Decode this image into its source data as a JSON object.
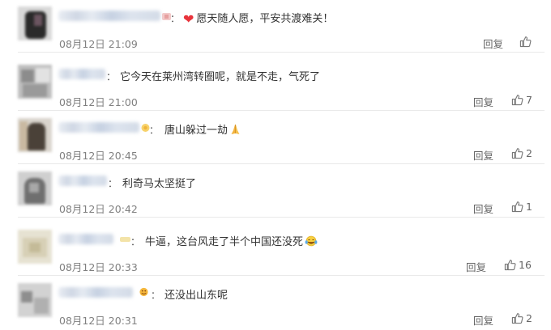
{
  "comments": [
    {
      "text": "愿天随人愿，平安共渡难关！",
      "time": "08月12日 21:09",
      "reply_label": "回复",
      "likes": ""
    },
    {
      "text": "它今天在莱州湾转圈呢，就是不走，气死了",
      "time": "08月12日 21:00",
      "reply_label": "回复",
      "likes": "7"
    },
    {
      "text": "唐山躲过一劫",
      "time": "08月12日 20:45",
      "reply_label": "回复",
      "likes": "2"
    },
    {
      "text": "利奇马太坚挺了",
      "time": "08月12日 20:42",
      "reply_label": "回复",
      "likes": "1"
    },
    {
      "text": "牛逼，这台风走了半个中国还没死",
      "time": "08月12日 20:33",
      "reply_label": "回复",
      "likes": "16"
    },
    {
      "text": "还没出山东呢",
      "time": "08月12日 20:31",
      "reply_label": "回复",
      "likes": "2"
    }
  ],
  "icons": {
    "heart": "red-heart-icon",
    "pray": "folded-hands-emoji",
    "laugh": "tears-of-joy-emoji",
    "like": "thumbs-up-icon"
  },
  "colors": {
    "accent": "#e8333b",
    "text": "#333333",
    "meta": "#808080"
  }
}
